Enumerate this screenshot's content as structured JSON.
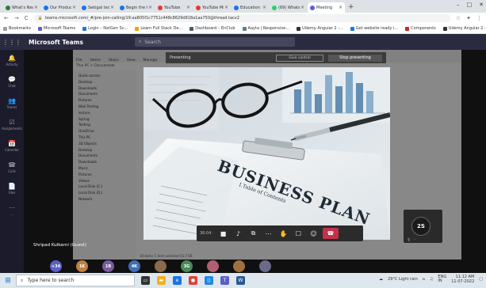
{
  "browser": {
    "tabs": [
      {
        "title": "What's New",
        "color": "#2e7d32"
      },
      {
        "title": "Our Products",
        "color": "#1a73e8"
      },
      {
        "title": "Sekigal tech",
        "color": "#1a73e8"
      },
      {
        "title": "Begin the Go",
        "color": "#1a73e8"
      },
      {
        "title": "YouTube",
        "color": "#e53935"
      },
      {
        "title": "YouTube Mix",
        "color": "#e53935"
      },
      {
        "title": "Education",
        "color": "#1a73e8"
      },
      {
        "title": "(69) WhatsApp",
        "color": "#25d366"
      },
      {
        "title": "Meeting",
        "color": "#5b5fc7",
        "active": true
      }
    ],
    "new_tab": "+",
    "window_controls": [
      "–",
      "□",
      "✕"
    ],
    "url": "teams.microsoft.com/_#/pre-join-calling/19:aa805f1c7751c448c8629d818a1aa750@thread.tacv2",
    "nav": [
      "←",
      "→",
      "C"
    ],
    "bookmarks": [
      {
        "label": "Bookmarks",
        "color": "#9aa0a6"
      },
      {
        "label": "Microsoft Teams",
        "color": "#5b5fc7"
      },
      {
        "label": "Login – NxtGen Sc...",
        "color": "#1a73e8"
      },
      {
        "label": "Learn Full Stack De...",
        "color": "#ff9800"
      },
      {
        "label": "Dashboard – EnClub",
        "color": "#455a64"
      },
      {
        "label": "Aayta | Responsive...",
        "color": "#607d8b"
      },
      {
        "label": "Udemy Angular 2 -...",
        "color": "#333333"
      },
      {
        "label": "Get website ready i...",
        "color": "#1a73e8"
      },
      {
        "label": "Components",
        "color": "#c62828"
      },
      {
        "label": "Udemy Angular 2 -...",
        "color": "#333333"
      }
    ]
  },
  "teams": {
    "app_title": "Microsoft Teams",
    "search_placeholder": "Search",
    "rail": [
      {
        "label": "Activity",
        "icon": "bell-icon"
      },
      {
        "label": "Chat",
        "icon": "chat-icon"
      },
      {
        "label": "Teams",
        "icon": "teams-icon"
      },
      {
        "label": "Assignments",
        "icon": "assignments-icon"
      },
      {
        "label": "Calendar",
        "icon": "calendar-icon"
      },
      {
        "label": "Calls",
        "icon": "phone-icon"
      },
      {
        "label": "Files",
        "icon": "files-icon"
      },
      {
        "label": "...",
        "icon": "more-icon"
      }
    ]
  },
  "meeting": {
    "presenting_label": "Presenting",
    "give_control": "Give control",
    "stop_presenting": "Stop presenting",
    "presenter_name": "Shripad Kulkarni (Guest)",
    "call_timer": "36:04",
    "participant_tile_initials": "2S",
    "participants": [
      {
        "initials": "+34",
        "color": "#5b5fc7"
      },
      {
        "initials": "1K",
        "color": "#c08040"
      },
      {
        "initials": "1B",
        "color": "#7a5c9e"
      },
      {
        "initials": "4K",
        "color": "#3f6fb5"
      },
      {
        "initials": "",
        "color": "#8a6a4a"
      },
      {
        "initials": "3G",
        "color": "#4a8a5a"
      },
      {
        "initials": "",
        "color": "#b06070"
      },
      {
        "initials": "",
        "color": "#a07040"
      },
      {
        "initials": "",
        "color": "#6a6a8a"
      }
    ]
  },
  "shared_screen": {
    "ribbon_tabs": [
      "File",
      "Home",
      "Share",
      "View",
      "Manage"
    ],
    "path": "This PC > Documents",
    "nav_items": [
      "Quick access",
      "Desktop",
      "Downloads",
      "Documents",
      "Pictures",
      "Web Testing",
      "lecture",
      "Spring",
      "Testing",
      "OneDrive",
      "This PC",
      "3D Objects",
      "Desktop",
      "Documents",
      "Downloads",
      "Music",
      "Pictures",
      "Videos",
      "Local Disk (C:)",
      "Local Disk (D:)",
      "Network"
    ],
    "status": "18 items   1 item selected  53.7 KB"
  },
  "photo": {
    "title": "BUSINESS PLAN",
    "subtitle": "I.Table of Contents"
  },
  "taskbar": {
    "search_placeholder": "Type here to search",
    "weather": "29°C Light rain",
    "lang": "ENG\nIN",
    "time": "11:12 AM",
    "date": "11-07-2022",
    "icons": [
      {
        "name": "task-view-icon",
        "color": "#333333",
        "glyph": "▭"
      },
      {
        "name": "file-explorer-icon",
        "color": "#f2b01e",
        "glyph": "▬"
      },
      {
        "name": "edge-icon",
        "color": "#1a73e8",
        "glyph": "e"
      },
      {
        "name": "chrome-icon",
        "color": "#db4437",
        "glyph": "●"
      },
      {
        "name": "vscode-icon",
        "color": "#1e88e5",
        "glyph": "⟨⟩"
      },
      {
        "name": "teams-app-icon",
        "color": "#5b5fc7",
        "glyph": "T"
      },
      {
        "name": "word-icon",
        "color": "#2b5797",
        "glyph": "W"
      }
    ]
  }
}
